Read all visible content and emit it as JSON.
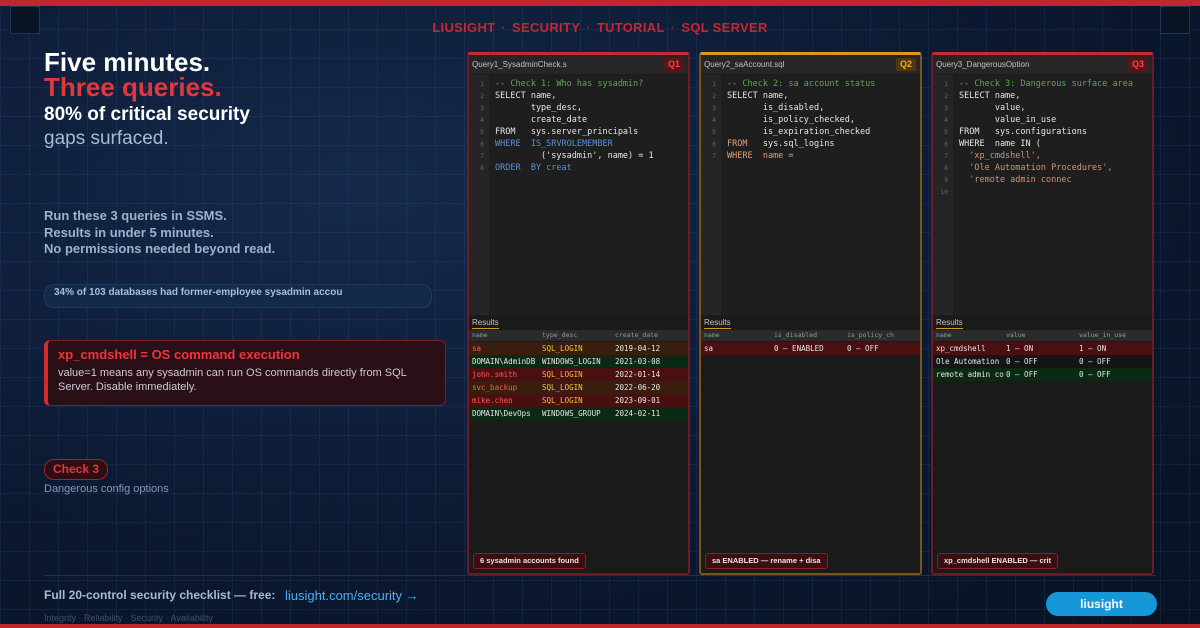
{
  "brand": {
    "line": [
      "LIUSIGHT",
      "SECURITY",
      "TUTORIAL",
      "SQL SERVER"
    ],
    "sep": "·",
    "accent": "#c0262b"
  },
  "headline": {
    "l1": "Five minutes.",
    "l2": "Three queries.",
    "l3": "80% of critical security",
    "l4": "gaps surfaced."
  },
  "lead": {
    "l1": "Run these 3 queries in SSMS.",
    "l2": "Results in under 5 minutes.",
    "l3": "No permissions needed beyond read."
  },
  "stat": "34% of 103 databases had former-employee sysadmin accou",
  "alert": {
    "title": "xp_cmdshell = OS command execution",
    "body": "value=1 means any sysadmin can run OS commands directly from SQL Server. Disable immediately."
  },
  "check": {
    "label": "Check 3",
    "sub": "Dangerous config options"
  },
  "cta": {
    "text": "Full 20-control security checklist — free:",
    "link": "liusight.com/security →"
  },
  "footer": "Integrity · Reliability · Security · Availability",
  "brand_button": "liusight",
  "panels": [
    {
      "file": "Query1_SysadminCheck.s",
      "qid": "Q1",
      "lines": [
        {
          "n": "1",
          "parts": [
            [
              "com",
              "-- Check 1: Who has sysadmin?"
            ]
          ]
        },
        {
          "n": "2",
          "parts": [
            [
              "txt",
              "SELECT name,"
            ]
          ]
        },
        {
          "n": "3",
          "parts": [
            [
              "txt",
              "       type_desc,"
            ]
          ]
        },
        {
          "n": "4",
          "parts": [
            [
              "txt",
              "       create_date"
            ]
          ]
        },
        {
          "n": "5",
          "parts": [
            [
              "txt",
              "FROM   sys.server_principals"
            ]
          ]
        },
        {
          "n": "6",
          "parts": [
            [
              "kw",
              "WHERE  IS_SRVROLEMEMBER"
            ]
          ]
        },
        {
          "n": "7",
          "parts": [
            [
              "txt",
              "         ('sysadmin', name) = 1"
            ]
          ]
        },
        {
          "n": "8",
          "parts": [
            [
              "kw",
              "ORDER  BY creat"
            ]
          ]
        }
      ],
      "results_tab": "Results",
      "columns": [
        "name",
        "type_desc",
        "create_date"
      ],
      "rows": [
        {
          "style": "brown",
          "cells": [
            "sa",
            "SQL_LOGIN",
            "2019-04-12"
          ],
          "hl": [
            0,
            1
          ]
        },
        {
          "style": "green",
          "cells": [
            "DOMAIN\\AdminDB",
            "WINDOWS_LOGIN",
            "2021-03-08"
          ],
          "hl": []
        },
        {
          "style": "red",
          "cells": [
            "john.smith",
            "SQL_LOGIN",
            "2022-01-14"
          ],
          "hl": [
            0,
            1
          ]
        },
        {
          "style": "brown",
          "cells": [
            "svc_backup",
            "SQL_LOGIN",
            "2022-06-20"
          ],
          "hl": [
            0,
            1
          ]
        },
        {
          "style": "red",
          "cells": [
            "mike.chen",
            "SQL_LOGIN",
            "2023-09-01"
          ],
          "hl": [
            0,
            1
          ]
        },
        {
          "style": "green",
          "cells": [
            "DOMAIN\\DevOps",
            "WINDOWS_GROUP",
            "2024-02-11"
          ],
          "hl": []
        }
      ],
      "badge": "6 sysadmin accounts found"
    },
    {
      "file": "Query2_saAccount.sql",
      "qid": "Q2",
      "lines": [
        {
          "n": "1",
          "parts": [
            [
              "com",
              "-- Check 2: sa account status"
            ]
          ]
        },
        {
          "n": "2",
          "parts": [
            [
              "txt",
              "SELECT name,"
            ]
          ]
        },
        {
          "n": "3",
          "parts": [
            [
              "txt",
              "       is_disabled,"
            ]
          ]
        },
        {
          "n": "4",
          "parts": [
            [
              "txt",
              "       is_policy_checked,"
            ]
          ]
        },
        {
          "n": "5",
          "parts": [
            [
              "txt",
              "       is_expiration_checked"
            ]
          ]
        },
        {
          "n": "6",
          "parts": [
            [
              "kw2",
              "FROM   "
            ],
            [
              "txt",
              "sys.sql_logins"
            ]
          ]
        },
        {
          "n": "7",
          "parts": [
            [
              "kw2",
              "WHERE  name ="
            ]
          ]
        }
      ],
      "results_tab": "Results",
      "columns": [
        "name",
        "is_disabled",
        "is_policy_ch"
      ],
      "rows": [
        {
          "style": "red",
          "cells": [
            "sa",
            "0 — ENABLED",
            "0 — OFF"
          ],
          "hl": []
        }
      ],
      "badge": "sa ENABLED — rename + disa"
    },
    {
      "file": "Query3_DangerousOption",
      "qid": "Q3",
      "lines": [
        {
          "n": "1",
          "parts": [
            [
              "com",
              "-- Check 3: Dangerous surface area"
            ]
          ]
        },
        {
          "n": "2",
          "parts": [
            [
              "txt",
              "SELECT name,"
            ]
          ]
        },
        {
          "n": "3",
          "parts": [
            [
              "txt",
              "       value,"
            ]
          ]
        },
        {
          "n": "4",
          "parts": [
            [
              "txt",
              "       value_in_use"
            ]
          ]
        },
        {
          "n": "5",
          "parts": [
            [
              "txt",
              "FROM   sys.configurations"
            ]
          ]
        },
        {
          "n": "6",
          "parts": [
            [
              "txt",
              "WHERE  name IN ("
            ]
          ]
        },
        {
          "n": "7",
          "parts": [
            [
              "str",
              "  'xp_cmdshell',"
            ]
          ]
        },
        {
          "n": "8",
          "parts": [
            [
              "str",
              "  'Ole Automation Procedures',"
            ]
          ]
        },
        {
          "n": "9",
          "parts": [
            [
              "str",
              "  'remote admin connec"
            ]
          ]
        },
        {
          "n": "10",
          "parts": [
            [
              "txt",
              ""
            ]
          ]
        }
      ],
      "results_tab": "Results",
      "columns": [
        "name",
        "value",
        "value_in_use"
      ],
      "rows": [
        {
          "style": "red",
          "cells": [
            "xp_cmdshell",
            "1 — ON",
            "1 — ON"
          ],
          "hl": []
        },
        {
          "style": "dark",
          "cells": [
            "Ole Automation P",
            "0 — OFF",
            "0 — OFF"
          ],
          "hl": []
        },
        {
          "style": "green",
          "cells": [
            "remote admin co",
            "0 — OFF",
            "0 — OFF"
          ],
          "hl": []
        }
      ],
      "badge": "xp_cmdshell ENABLED — crit"
    }
  ]
}
